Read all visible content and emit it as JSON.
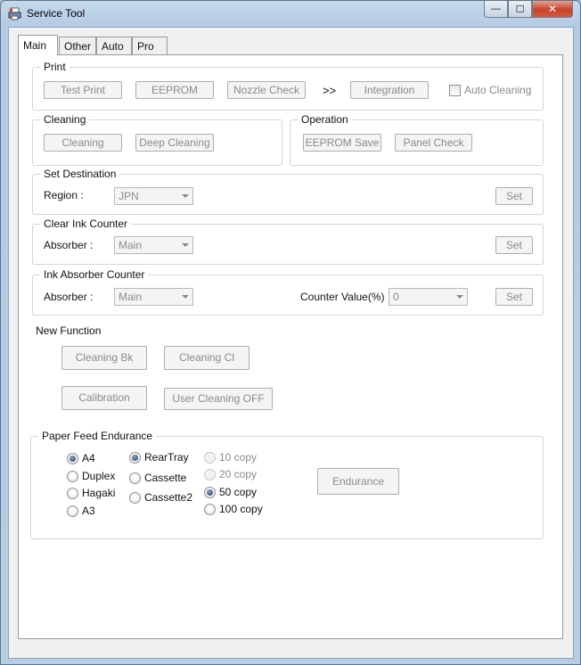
{
  "window": {
    "title": "Service Tool",
    "minimize_glyph": "—",
    "maximize_glyph": "☐",
    "close_glyph": "✕"
  },
  "tabs": [
    "Main",
    "Other",
    "Auto",
    "Pro"
  ],
  "print": {
    "group_label": "Print",
    "test_print": "Test Print",
    "eeprom": "EEPROM",
    "nozzle_check": "Nozzle Check",
    "arrows": ">>",
    "integration": "Integration",
    "auto_cleaning": "Auto Cleaning"
  },
  "cleaning": {
    "group_label": "Cleaning",
    "cleaning": "Cleaning",
    "deep_cleaning": "Deep Cleaning"
  },
  "operation": {
    "group_label": "Operation",
    "eeprom_save": "EEPROM Save",
    "panel_check": "Panel Check"
  },
  "set_destination": {
    "group_label": "Set Destination",
    "region_label": "Region :",
    "region_value": "JPN",
    "set": "Set"
  },
  "clear_ink_counter": {
    "group_label": "Clear Ink Counter",
    "absorber_label": "Absorber :",
    "absorber_value": "Main",
    "set": "Set"
  },
  "ink_absorber_counter": {
    "group_label": "Ink Absorber Counter",
    "absorber_label": "Absorber :",
    "absorber_value": "Main",
    "counter_label": "Counter Value(%) :",
    "counter_value": "0",
    "set": "Set"
  },
  "new_function": {
    "label": "New Function",
    "cleaning_bk": "Cleaning Bk",
    "cleaning_cl": "Cleaning Cl",
    "calibration": "Calibration",
    "user_cleaning_off": "User Cleaning OFF"
  },
  "paper_feed": {
    "group_label": "Paper Feed Endurance",
    "sizes": [
      "A4",
      "Duplex",
      "Hagaki",
      "A3"
    ],
    "size_selected": "A4",
    "trays": [
      "RearTray",
      "Cassette",
      "Cassette2"
    ],
    "tray_selected": "RearTray",
    "copies": [
      "10 copy",
      "20 copy",
      "50 copy",
      "100 copy"
    ],
    "copies_selected": "50 copy",
    "endurance": "Endurance"
  },
  "colors": {
    "title_bar": "#b3cbe3",
    "close_button": "#c7432a",
    "disabled_text": "#8a8a8a",
    "panel_bg": "#ffffff"
  }
}
